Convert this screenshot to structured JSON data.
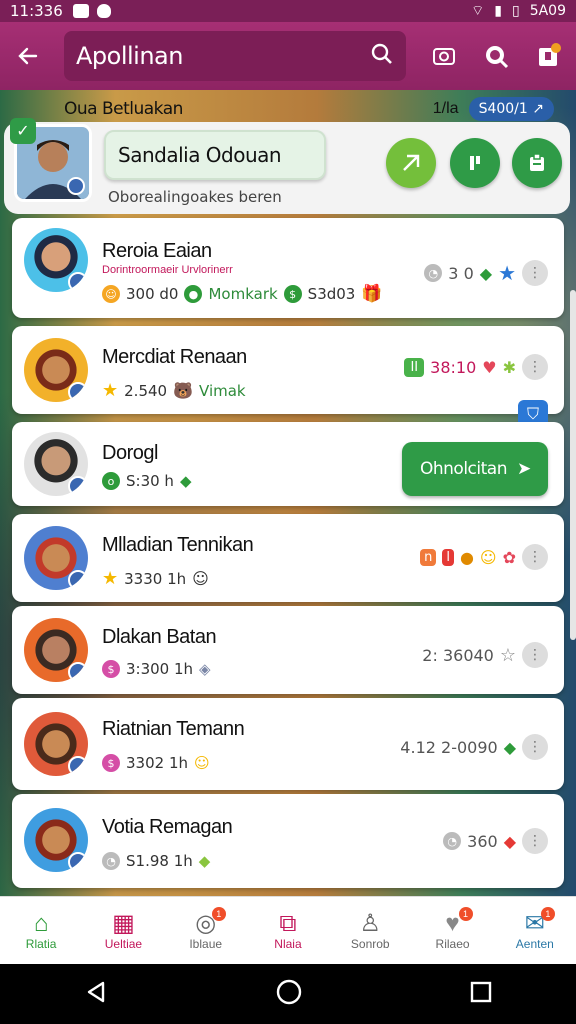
{
  "status_bar": {
    "time": "11:336",
    "right": "5A09"
  },
  "app_bar": {
    "search_text": "Apollinan"
  },
  "banner": {
    "left_text": "Oua Betluakan",
    "right_small": "1/la",
    "pill": "S400/1 ↗"
  },
  "header": {
    "name": "Sandalia Odouan",
    "subtitle": "Oborealingoakes beren"
  },
  "rows": [
    {
      "name": "Reroia Eaian",
      "sub": "Dorintroormaeir Urvlorinerr",
      "v1": "300 d0",
      "v2": "Momkark",
      "v3": "S3d03",
      "right": "3 0"
    },
    {
      "name": "Mercdiat Renaan",
      "v1": "2.540",
      "v2": "Vimak",
      "right": "38:10"
    },
    {
      "name": "Dorogl",
      "v1": "S:30 h",
      "button": "Ohnolcitan"
    },
    {
      "name": "Mlladian Tennikan",
      "v1": "3330 1h"
    },
    {
      "name": "Dlakan Batan",
      "v1": "3:300 1h",
      "right": "2: 36040"
    },
    {
      "name": "Riatnian Temann",
      "v1": "3302 1h",
      "right": "4.12 2-0090"
    },
    {
      "name": "Votia Remagan",
      "v1": "S1.98 1h",
      "right": "360"
    }
  ],
  "bottom_nav": [
    {
      "label": "Rlatia",
      "icon": "home-icon"
    },
    {
      "label": "Ueltiae",
      "icon": "shop-icon"
    },
    {
      "label": "Iblaue",
      "icon": "target-icon"
    },
    {
      "label": "Nlaia",
      "icon": "bag-icon"
    },
    {
      "label": "Sonrob",
      "icon": "person-icon"
    },
    {
      "label": "Rilaeo",
      "icon": "heart-icon"
    },
    {
      "label": "Aenten",
      "icon": "chat-icon"
    }
  ],
  "colors": {
    "primary": "#9b2a6b",
    "accent_green": "#2f9b47",
    "badge_blue": "#3a67b1"
  }
}
